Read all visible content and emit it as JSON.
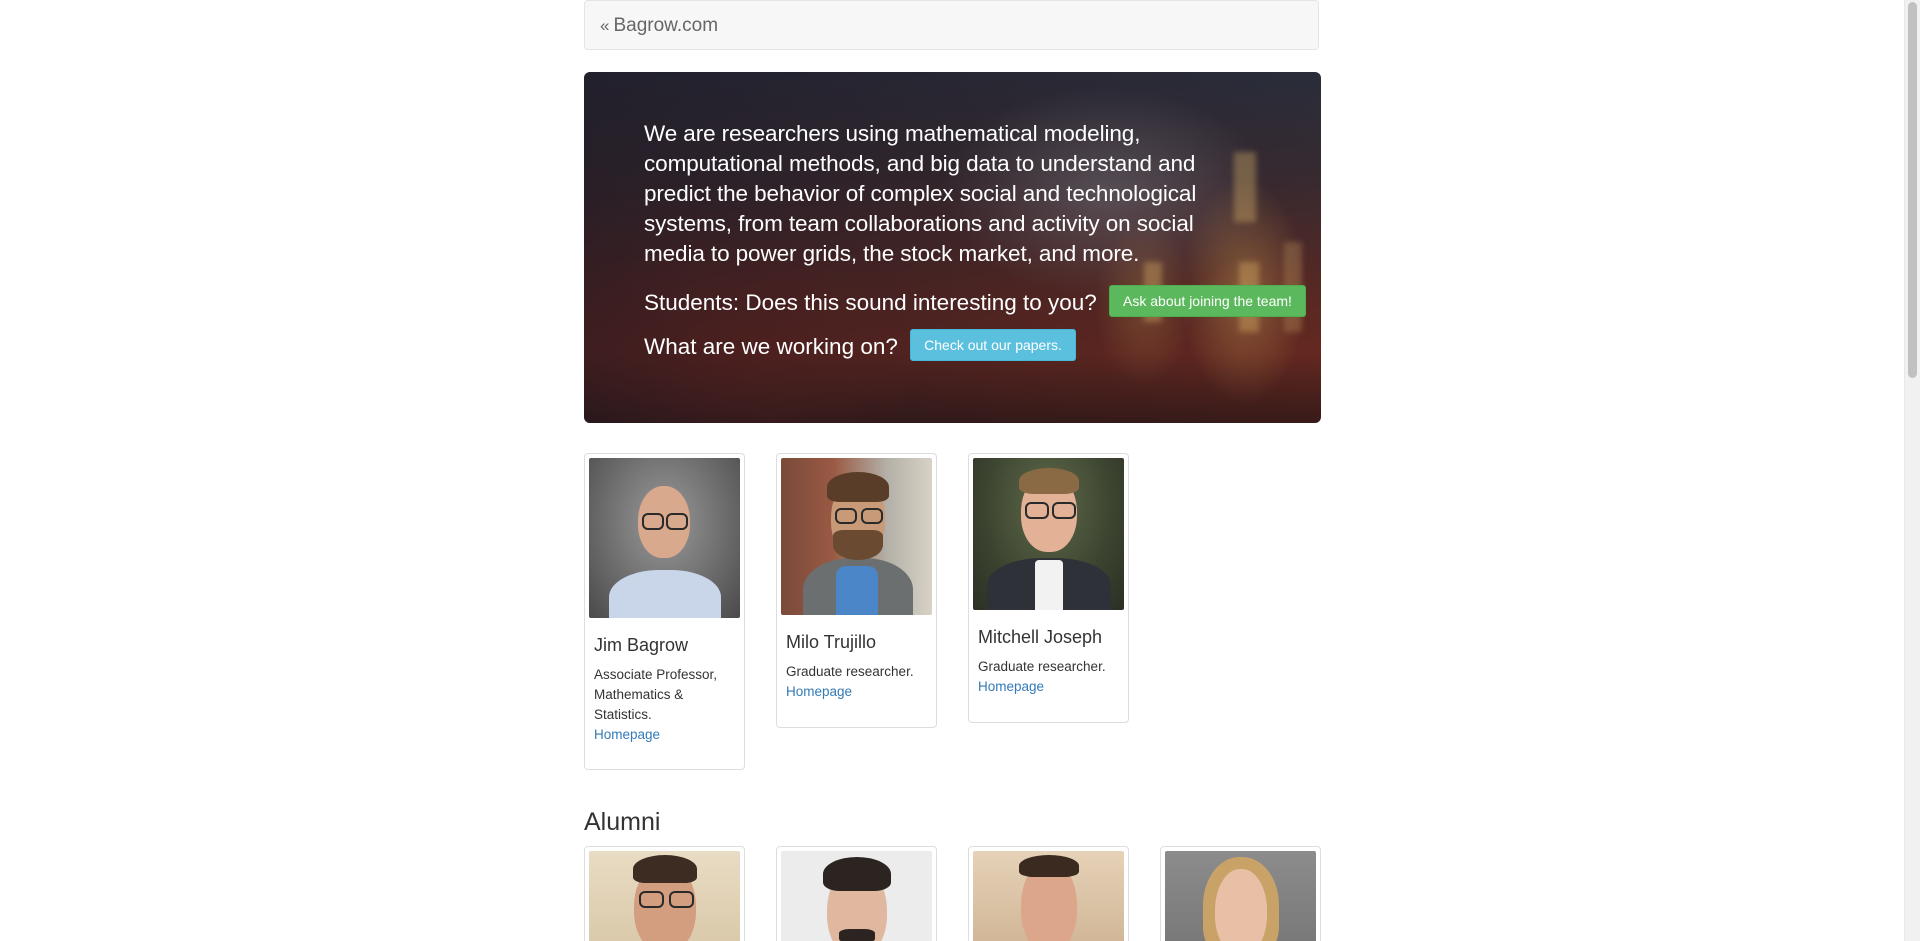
{
  "nav": {
    "back_label": "Bagrow.com",
    "back_icon": "double-chevron-left-icon"
  },
  "hero": {
    "intro": "We are researchers using mathematical modeling, computational methods, and big data to understand and predict the behavior of complex social and technological systems, from team collaborations and activity on social media to power grids, the stock market, and more.",
    "students_question": "Students: Does this sound interesting to you?",
    "join_button": "Ask about joining the team!",
    "work_question": "What are we working on?",
    "papers_button": "Check out our papers.",
    "colors": {
      "join_button": "#5cb85c",
      "papers_button": "#5bc0de"
    }
  },
  "team": [
    {
      "name": "Jim Bagrow",
      "role": "Associate Professor, Mathematics & Statistics.",
      "link": "Homepage"
    },
    {
      "name": "Milo Trujillo",
      "role": "Graduate researcher.",
      "link": "Homepage"
    },
    {
      "name": "Mitchell Joseph",
      "role": "Graduate researcher.",
      "link": "Homepage"
    }
  ],
  "alumni": {
    "title": "Alumni"
  }
}
